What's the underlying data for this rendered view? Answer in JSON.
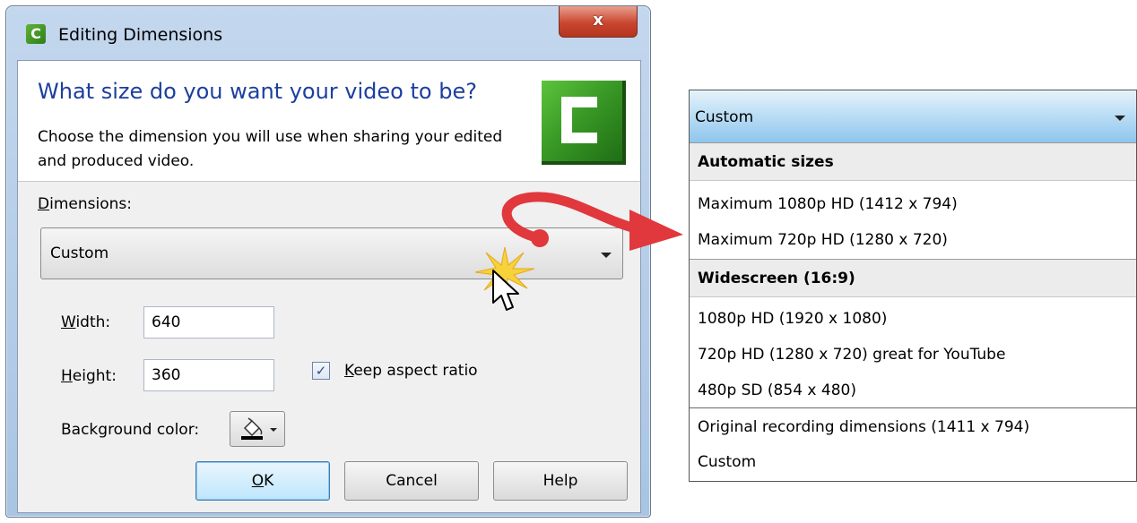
{
  "window": {
    "title": "Editing Dimensions",
    "close_symbol": "x",
    "app_icon_letter": "C"
  },
  "header": {
    "heading": "What size do you want your video to be?",
    "description": "Choose the dimension you will use when sharing your edited and produced video."
  },
  "dimensions": {
    "label_prefix": "D",
    "label_rest": "imensions:",
    "selected": "Custom"
  },
  "width": {
    "label_prefix": "W",
    "label_rest": "idth:",
    "value": "640"
  },
  "height": {
    "label_prefix": "H",
    "label_rest": "eight:",
    "value": "360"
  },
  "keep_aspect": {
    "checked": true,
    "check_glyph": "✓",
    "label_prefix": "K",
    "label_rest": "eep aspect ratio"
  },
  "background": {
    "label": "Background color:"
  },
  "buttons": {
    "ok_prefix": "O",
    "ok_rest": "K",
    "cancel": "Cancel",
    "help": "Help"
  },
  "dropdown_list": {
    "selected": "Custom",
    "groups": [
      {
        "title": "Automatic sizes",
        "items": [
          "Maximum 1080p HD (1412 x 794)",
          "Maximum 720p HD (1280 x 720)"
        ]
      },
      {
        "title": "Widescreen (16:9)",
        "items": [
          "1080p HD (1920 x 1080)",
          "720p HD (1280 x 720) great for YouTube",
          "480p SD (854 x 480)"
        ]
      }
    ],
    "extra_items": [
      "Original recording dimensions (1411 x 794)",
      "Custom"
    ]
  },
  "colors": {
    "heading": "#1c3f9e",
    "arrow": "#e0383c",
    "list_header": "#8ec6ec",
    "logo_green": "#3a9a26"
  }
}
